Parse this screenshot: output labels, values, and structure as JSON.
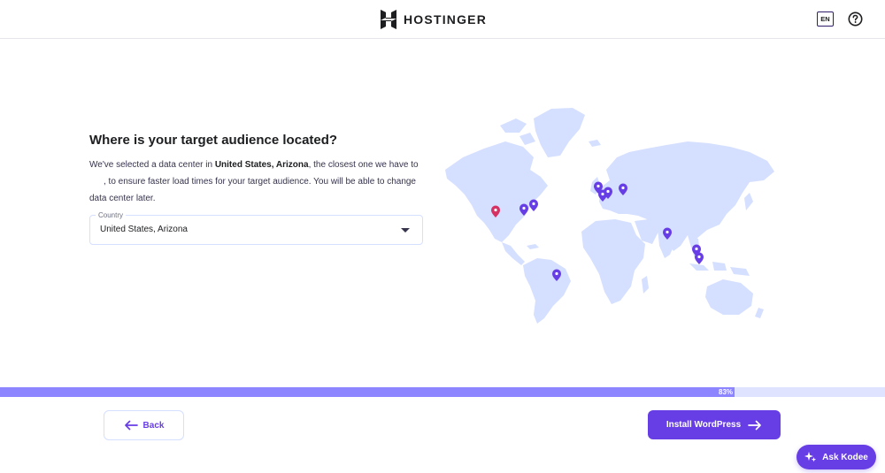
{
  "header": {
    "brand": "HOSTINGER",
    "language": "EN",
    "icons": {
      "logo": "hostinger-logo-icon",
      "help": "help-circle-icon"
    }
  },
  "main": {
    "heading": "Where is your target audience located?",
    "description": {
      "prefix": "We've selected a data center in ",
      "location": "United States, Arizona",
      "middle": ", the closest one we have to",
      "line2": ", to ensure faster load times for your target audience. You will be able to change data center later."
    },
    "country_select": {
      "label": "Country",
      "value": "United States, Arizona",
      "icon": "chevron-down-icon"
    },
    "map": {
      "icon": "world-map",
      "selected_marker_color": "#d63163",
      "marker_color": "#673de6",
      "land_color": "#d5dfff"
    }
  },
  "progress": {
    "value": 83,
    "label": "83%"
  },
  "footer": {
    "back_label": "Back",
    "install_label": "Install WordPress"
  },
  "assistant": {
    "label": "Ask Kodee"
  },
  "colors": {
    "primary": "#673de6",
    "progress_fill": "#8c85ff",
    "progress_track": "#dfe3ff"
  }
}
